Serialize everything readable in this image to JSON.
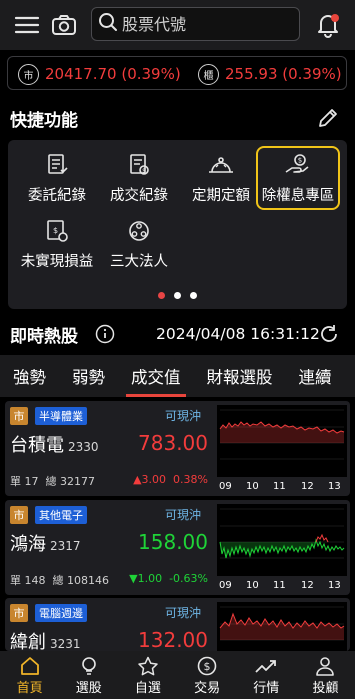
{
  "header": {
    "search_placeholder": "股票代號"
  },
  "indices": [
    {
      "icon_text": "市",
      "value": "20417.70 (0.39%)"
    },
    {
      "icon_text": "櫃",
      "value": "255.93 (0.39%)"
    }
  ],
  "quick": {
    "title": "快捷功能",
    "items": [
      {
        "label": "委託紀錄",
        "icon": "order-record-icon"
      },
      {
        "label": "成交紀錄",
        "icon": "trade-record-icon"
      },
      {
        "label": "定期定額",
        "icon": "regular-investment-icon"
      },
      {
        "label": "除權息專區",
        "icon": "dividend-zone-icon"
      },
      {
        "label": "未實現損益",
        "icon": "unrealized-pl-icon"
      },
      {
        "label": "三大法人",
        "icon": "institutional-investors-icon"
      }
    ]
  },
  "hot": {
    "title": "即時熱股",
    "timestamp": "2024/04/08 16:31:12"
  },
  "tabs": [
    "強勢",
    "弱勢",
    "成交值",
    "財報選股",
    "連續"
  ],
  "active_tab": 2,
  "stocks": [
    {
      "market": "市",
      "industry": "半導體業",
      "tag": "可現沖",
      "name": "台積電",
      "code": "2330",
      "price": "783.00",
      "vol_label": "單 17",
      "total_label": "總 32177",
      "change": "▲3.00",
      "pct": "0.38%",
      "dir": "up",
      "axis": [
        "09",
        "10",
        "11",
        "12",
        "13"
      ]
    },
    {
      "market": "市",
      "industry": "其他電子",
      "tag": "可現沖",
      "name": "鴻海",
      "code": "2317",
      "price": "158.00",
      "vol_label": "單 148",
      "total_label": "總 108146",
      "change": "▼1.00",
      "pct": "-0.63%",
      "dir": "down",
      "axis": [
        "09",
        "10",
        "11",
        "12",
        "13"
      ]
    },
    {
      "market": "市",
      "industry": "電腦週邊",
      "tag": "可現沖",
      "name": "緯創",
      "code": "3231",
      "price": "132.00",
      "vol_label": "",
      "total_label": "",
      "change": "",
      "pct": "",
      "dir": "up",
      "axis": []
    }
  ],
  "bottom_nav": [
    "首頁",
    "選股",
    "自選",
    "交易",
    "行情",
    "投顧"
  ],
  "colors": {
    "up": "#f23c3c",
    "down": "#1fd338",
    "accent": "#f0c419",
    "tab_underline": "#e8453c"
  }
}
